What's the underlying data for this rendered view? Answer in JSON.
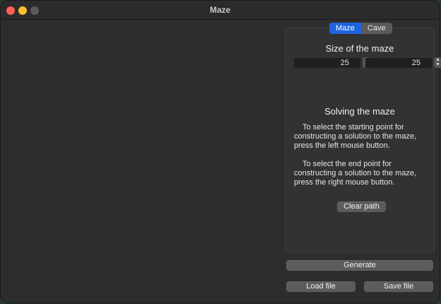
{
  "window": {
    "title": "Maze"
  },
  "tabs": [
    {
      "label": "Maze",
      "active": true
    },
    {
      "label": "Cave",
      "active": false
    }
  ],
  "size": {
    "heading": "Size of the maze",
    "rows_value": "25",
    "cols_value": "25"
  },
  "solving": {
    "heading": "Solving the maze",
    "start_text": "To select the starting point for constructing a solution to the maze, press the left mouse button.",
    "end_text": "To select the end point for constructing a solution to the maze, press the right mouse button.",
    "clear_label": "Clear path"
  },
  "actions": {
    "generate_label": "Generate",
    "load_label": "Load file",
    "save_label": "Save file"
  },
  "colors": {
    "accent": "#1f63e0",
    "close": "#ff5f57",
    "minimize": "#febc2e"
  }
}
